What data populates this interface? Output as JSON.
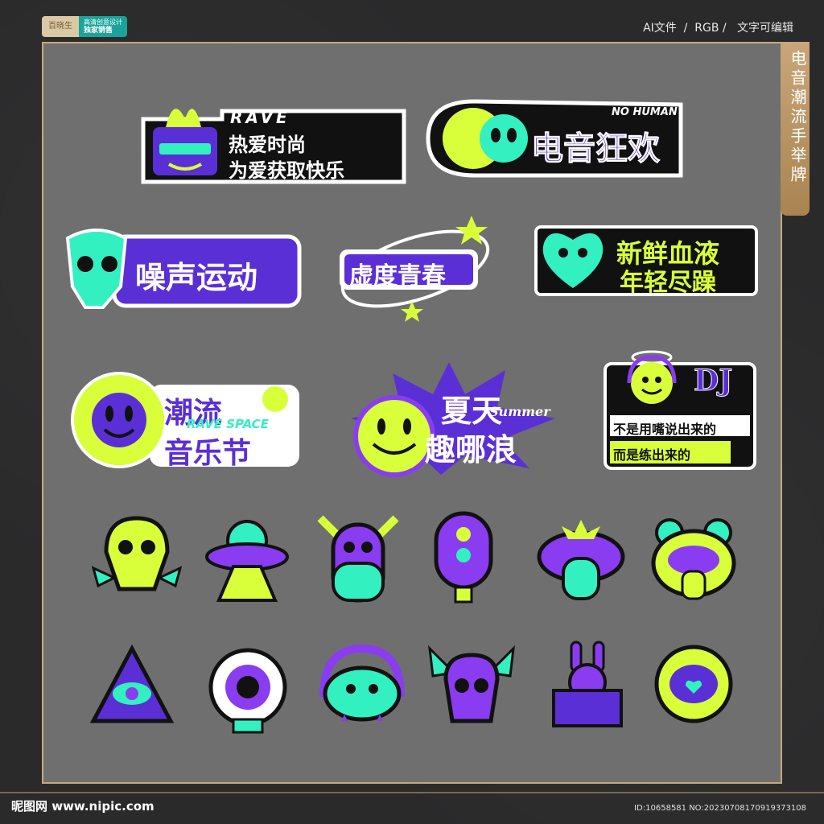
{
  "header": {
    "badge_left": "百晓生",
    "badge_right_line1": "高清创意设计",
    "badge_right_line2": "独家销售",
    "info": "AI文件  /  RGB /   文字可编辑"
  },
  "side_tab": {
    "text": "电音潮流手举牌"
  },
  "stickers": {
    "rave": {
      "top": "RAVE",
      "line1": "热爱时尚",
      "line2": "为爱获取快乐"
    },
    "dianyin": {
      "main": "电音狂欢",
      "sub": "NO HUMAN"
    },
    "zaosheng": {
      "text": "噪声运动"
    },
    "xudu": {
      "text": "虚度青春"
    },
    "xinxian": {
      "line1": "新鲜血液",
      "line2": "年轻尽躁"
    },
    "chaoliu": {
      "line1": "潮流",
      "line2": "音乐节",
      "overlay": "RAVE SPACE"
    },
    "xiatian": {
      "line1": "夏天",
      "line2": "趣哪浪",
      "script": "Summer"
    },
    "dj": {
      "title": "DJ",
      "line1": "不是用嘴说出来的",
      "line2": "而是练出来的"
    }
  },
  "colors": {
    "purple": "#5b2fd6",
    "violet": "#8a3cf0",
    "lime": "#d9ff3a",
    "mint": "#33f0c0",
    "black": "#111111",
    "white": "#ffffff",
    "frame_gray": "#6f6f70",
    "gold": "#c8a97a"
  },
  "icons": [
    "mushroom-skull-icon",
    "ufo-alien-icon",
    "horned-monster-icon",
    "eye-popsicle-icon",
    "lips-monster-icon",
    "frog-monster-icon",
    "triangle-eye-icon",
    "mushroom-eye-icon",
    "rainbow-cloud-icon",
    "winged-skull-icon",
    "rabbit-box-icon",
    "mouth-heart-icon"
  ],
  "footer": {
    "watermark": "昵图网 www.nipic.com",
    "id": "ID:10658581 NO:20230708170919373108"
  }
}
